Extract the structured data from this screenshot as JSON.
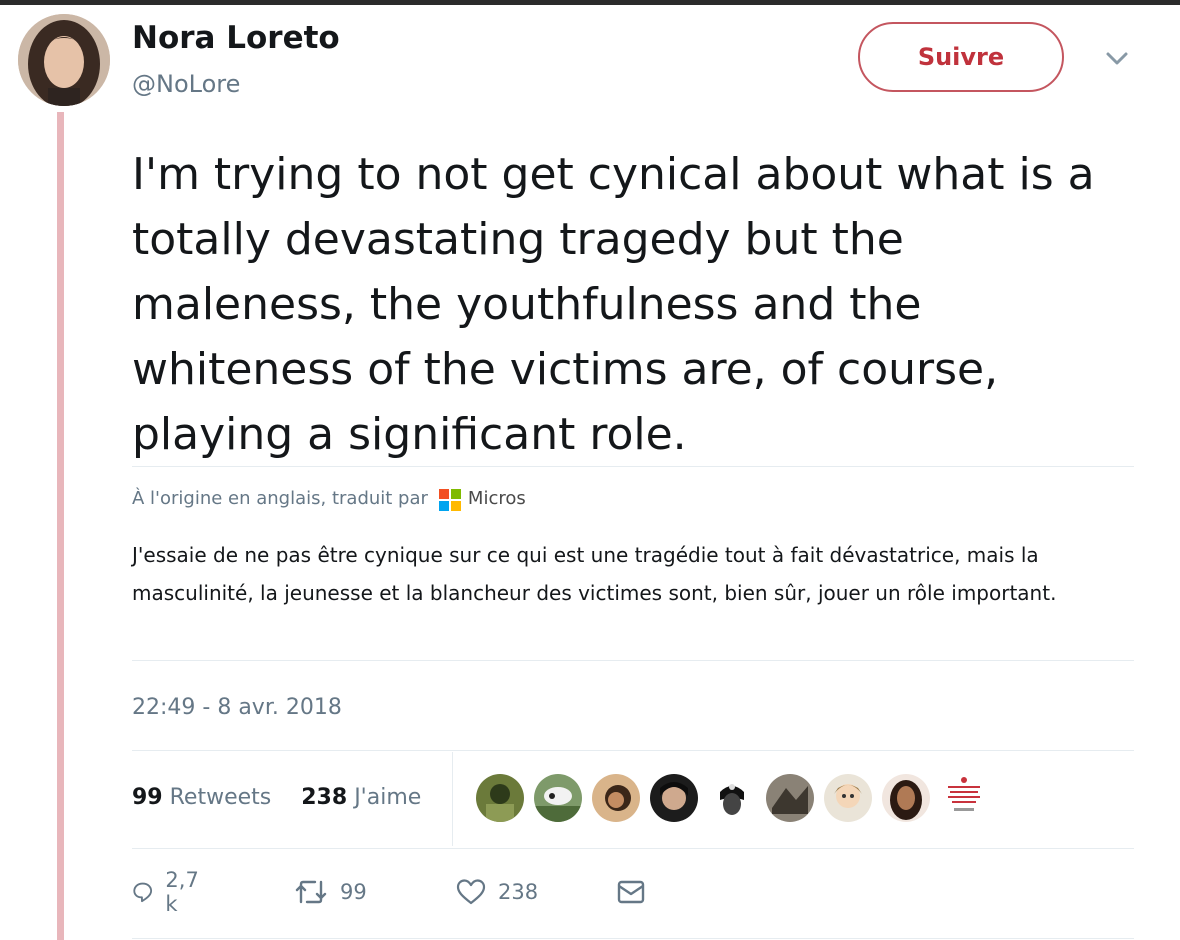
{
  "author": {
    "name": "Nora Loreto",
    "handle": "@NoLore"
  },
  "follow_label": "Suivre",
  "tweet_text": "I'm trying to not get cynical about what is a totally devastating tragedy but the maleness, the youthfulness and the whiteness of the victims are, of course, playing a significant role.",
  "translation": {
    "label": "À l'origine en anglais, traduit par",
    "provider": "Micros",
    "text": "J'essaie de ne pas être cynique sur ce qui est une tragédie tout à fait dévastatrice, mais la masculinité, la jeunesse et la blancheur des victimes sont, bien sûr, jouer un rôle important."
  },
  "timestamp": "22:49 - 8 avr. 2018",
  "stats": {
    "retweets_count": "99",
    "retweets_label": "Retweets",
    "likes_count": "238",
    "likes_label": "J'aime"
  },
  "actions": {
    "reply_count": "2,7 k",
    "retweet_count": "99",
    "like_count": "238"
  },
  "icons": {
    "menu": "chevron-down-icon",
    "reply": "reply-icon",
    "retweet": "retweet-icon",
    "like": "heart-icon",
    "dm": "envelope-icon"
  },
  "colors": {
    "follow_accent": "#c0323c",
    "thread_line": "#e8b6bb",
    "secondary_text": "#657786"
  }
}
